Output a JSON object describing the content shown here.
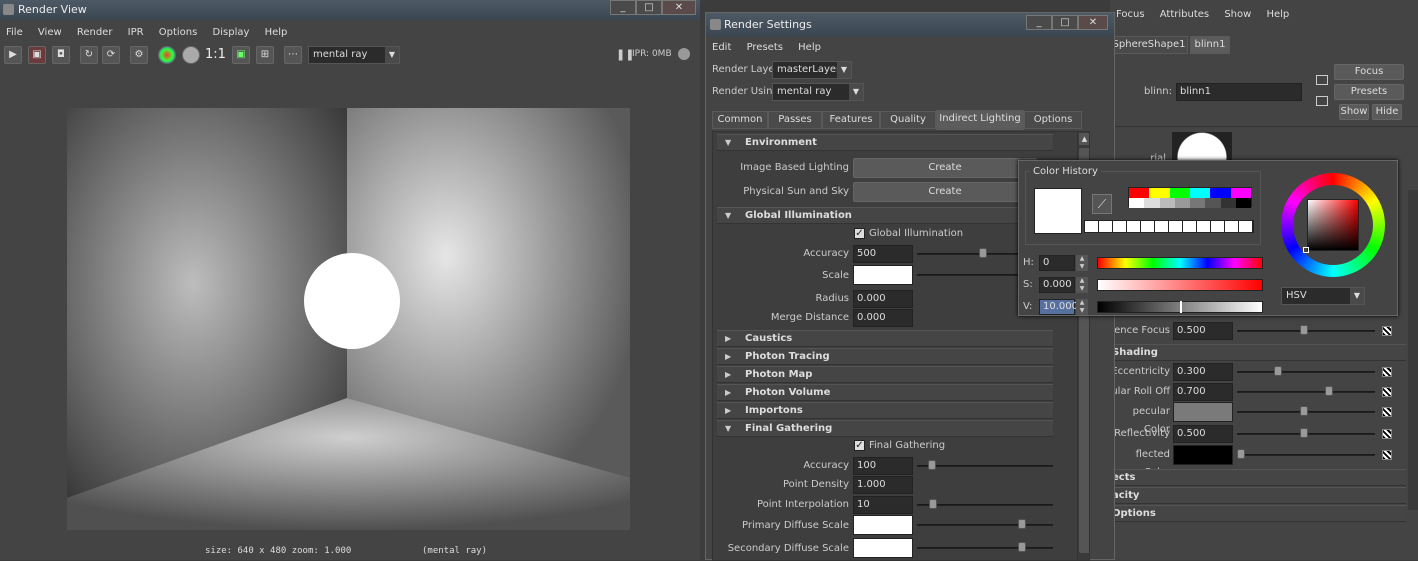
{
  "render_view": {
    "title": "Render View",
    "menus": [
      "File",
      "View",
      "Render",
      "IPR",
      "Options",
      "Display",
      "Help"
    ],
    "renderer": "mental ray",
    "ratio_label": "1:1",
    "ipr_label": "IPR: 0MB",
    "status_size": "size: 640 x 480  zoom: 1.000",
    "status_renderer": "(mental ray)"
  },
  "render_settings": {
    "title": "Render Settings",
    "menus": [
      "Edit",
      "Presets",
      "Help"
    ],
    "render_layer_label": "Render Layer",
    "render_layer_value": "masterLayer",
    "render_using_label": "Render Using",
    "render_using_value": "mental ray",
    "tabs": [
      "Common",
      "Passes",
      "Features",
      "Quality",
      "Indirect Lighting",
      "Options"
    ],
    "sections": {
      "environment": "Environment",
      "ibl_label": "Image Based Lighting",
      "ibl_btn": "Create",
      "sun_label": "Physical Sun and Sky",
      "sun_btn": "Create",
      "gi": "Global Illumination",
      "gi_check": "Global Illumination",
      "accuracy_label": "Accuracy",
      "accuracy_value": "500",
      "scale_label": "Scale",
      "radius_label": "Radius",
      "radius_value": "0.000",
      "merge_label": "Merge Distance",
      "merge_value": "0.000",
      "caustics": "Caustics",
      "photon_tracing": "Photon Tracing",
      "photon_map": "Photon Map",
      "photon_volume": "Photon Volume",
      "importons": "Importons",
      "final_gathering": "Final Gathering",
      "fg_check": "Final Gathering",
      "fg_accuracy_label": "Accuracy",
      "fg_accuracy_value": "100",
      "point_density_label": "Point Density",
      "point_density_value": "1.000",
      "point_interp_label": "Point Interpolation",
      "point_interp_value": "10",
      "primary_diffuse_label": "Primary Diffuse Scale",
      "secondary_diffuse_label": "Secondary Diffuse Scale"
    }
  },
  "attribute_editor": {
    "menus": [
      "Focus",
      "Attributes",
      "Show",
      "Help"
    ],
    "tabs": [
      "SphereShape1",
      "blinn1"
    ],
    "blinn_label": "blinn:",
    "blinn_value": "blinn1",
    "focus_btn": "Focus",
    "presets_btn": "Presets",
    "show_btn": "Show",
    "hide_btn": "Hide",
    "material_sample": "rial Sample",
    "specular_focus_label": "ence Focus",
    "specular_focus_value": "0.500",
    "shading_header": "Shading",
    "eccentricity_label": "Eccentricity",
    "eccentricity_value": "0.300",
    "rolloff_label": "ular Roll Off",
    "rolloff_value": "0.700",
    "spec_color_label": "pecular Color",
    "reflectivity_label": "Reflectivity",
    "reflectivity_value": "0.500",
    "reflected_color_label": "flected Color",
    "effects_header": "ects",
    "opacity_header": "acity",
    "options_header": "Options"
  },
  "color_chooser": {
    "history_label": "Color History",
    "h_label": "H:",
    "h_value": "0",
    "s_label": "S:",
    "s_value": "0.000",
    "v_label": "V:",
    "v_value": "10.000",
    "mode": "HSV"
  }
}
